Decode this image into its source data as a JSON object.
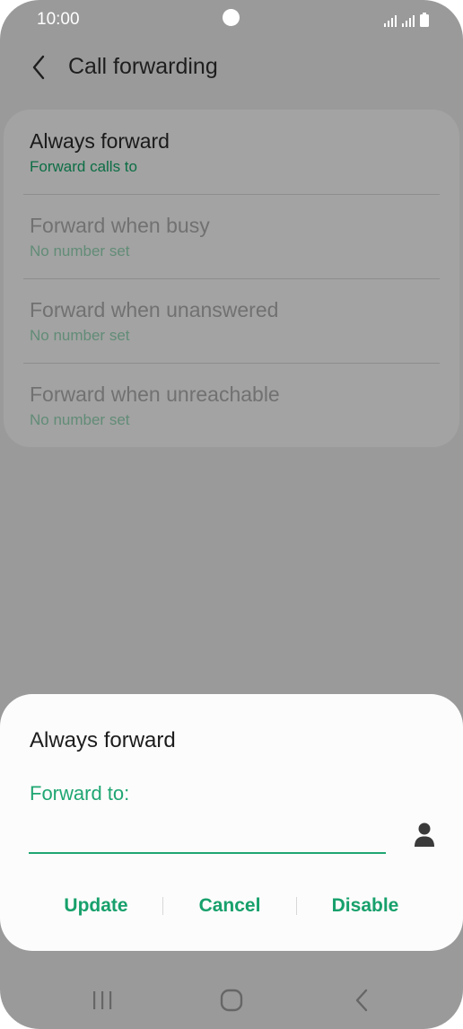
{
  "status_bar": {
    "time": "10:00"
  },
  "header": {
    "title": "Call forwarding",
    "back_icon": "chevron-left-icon"
  },
  "settings": {
    "items": [
      {
        "title": "Always forward",
        "subtitle": "Forward calls to",
        "enabled": true
      },
      {
        "title": "Forward when busy",
        "subtitle": "No number set",
        "enabled": false
      },
      {
        "title": "Forward when unanswered",
        "subtitle": "No number set",
        "enabled": false
      },
      {
        "title": "Forward when unreachable",
        "subtitle": "No number set",
        "enabled": false
      }
    ]
  },
  "dialog": {
    "title": "Always forward",
    "field_label": "Forward to:",
    "field_value": "",
    "contact_icon": "person-icon",
    "actions": {
      "update": "Update",
      "cancel": "Cancel",
      "disable": "Disable"
    }
  },
  "nav": {
    "recents_icon": "recents-icon",
    "home_icon": "home-icon",
    "back_icon": "back-icon"
  },
  "colors": {
    "accent": "#1fa672",
    "scrim": "#9a9a9a",
    "dialog_bg": "#fcfcfc"
  }
}
